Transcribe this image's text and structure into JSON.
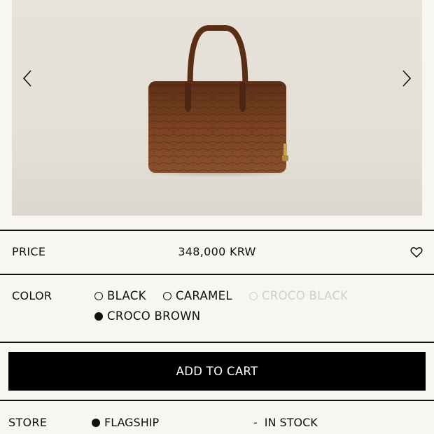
{
  "gallery": {
    "prev_icon": "chevron-left-icon",
    "next_icon": "chevron-right-icon"
  },
  "price": {
    "label": "PRICE",
    "value": "348,000 KRW",
    "wishlist_icon": "heart-icon"
  },
  "color": {
    "label": "COLOR",
    "options": [
      {
        "label": "BLACK",
        "selected": false,
        "available": true
      },
      {
        "label": "CARAMEL",
        "selected": false,
        "available": true
      },
      {
        "label": "CROCO BLACK",
        "selected": false,
        "available": false
      },
      {
        "label": "CROCO BROWN",
        "selected": true,
        "available": true
      }
    ]
  },
  "cart": {
    "label": "ADD TO CART"
  },
  "store": {
    "label": "STORE",
    "name": "FLAGSHIP",
    "separator": "-",
    "status": "IN STOCK"
  },
  "colors": {
    "background": "#f7f6f0",
    "text": "#111111",
    "disabled": "#cfcfcf",
    "button": "#000000",
    "bag_leather": "#6e3a1c"
  }
}
